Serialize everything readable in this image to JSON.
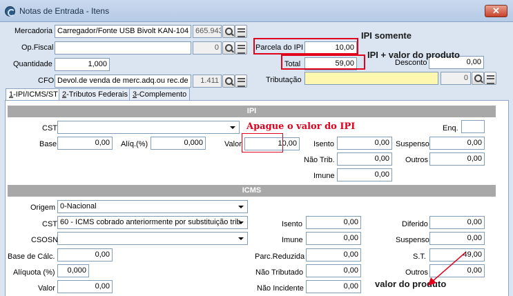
{
  "window": {
    "title": "Notas de Entrada - Itens",
    "close": "✕"
  },
  "header": {
    "mercadoria": {
      "label": "Mercadoria",
      "value": "Carregador/Fonte USB Bivolt KAN-104 -",
      "code": "665.943"
    },
    "opfiscal": {
      "label": "Op.Fiscal",
      "value": "",
      "code": "0"
    },
    "quantidade": {
      "label": "Quantidade",
      "value": "1,000"
    },
    "cfo": {
      "label": "CFO",
      "value": "Devol.de venda de merc.adq.ou rec.de",
      "code": "1.411"
    },
    "parcela_ipi": {
      "label": "Parcela do IPI",
      "value": "10,00"
    },
    "total": {
      "label": "Total",
      "value": "59,00"
    },
    "desconto": {
      "label": "Desconto",
      "value": "0,00"
    },
    "tributacao": {
      "label": "Tributação",
      "value": "",
      "code": "0"
    }
  },
  "tabs": [
    {
      "key": "1",
      "label": "-IPI/ICMS/ST"
    },
    {
      "key": "2",
      "label": "-Tributos Federais"
    },
    {
      "key": "3",
      "label": "-Complemento"
    }
  ],
  "ipi": {
    "title": "IPI",
    "cst_label": "CST",
    "cst_value": "",
    "enq_label": "Enq.",
    "enq_value": "",
    "base_label": "Base",
    "base_value": "0,00",
    "aliq_label": "Alíq.(%)",
    "aliq_value": "0,000",
    "valor_label": "Valor",
    "valor_value": "10,00",
    "isento_label": "Isento",
    "isento_value": "0,00",
    "suspenso_label": "Suspenso",
    "suspenso_value": "0,00",
    "naotrib_label": "Não Trib.",
    "naotrib_value": "0,00",
    "outros_label": "Outros",
    "outros_value": "0,00",
    "imune_label": "Imune",
    "imune_value": "0,00"
  },
  "icms": {
    "title": "ICMS",
    "origem_label": "Origem",
    "origem_value": "0-Nacional",
    "cst_label": "CST",
    "cst_value": "60 - ICMS cobrado anteriormente por substituição trib",
    "csosn_label": "CSOSN",
    "csosn_value": "",
    "base_label": "Base de Cálc.",
    "base_value": "0,00",
    "aliq_label": "Alíquota (%)",
    "aliq_value": "0,000",
    "valor_label": "Valor",
    "valor_value": "0,00",
    "isento_label": "Isento",
    "isento_value": "0,00",
    "imune_label": "Imune",
    "imune_value": "0,00",
    "parcred_label": "Parc.Reduzida",
    "parcred_value": "0,00",
    "naotrib_label": "Não Tributado",
    "naotrib_value": "0,00",
    "naoinc_label": "Não Incidente",
    "naoinc_value": "0,00",
    "diferido_label": "Diferido",
    "diferido_value": "0,00",
    "suspenso_label": "Suspenso",
    "suspenso_value": "0,00",
    "st_label": "S.T.",
    "st_value": "49,00",
    "outros_label": "Outros",
    "outros_value": "0,00"
  },
  "annotations": {
    "ipi_somente": "IPI somente",
    "ipi_mais_produto": "IPI + valor do produto",
    "apague": "Apague o valor do IPI",
    "valor_produto": "valor do produto"
  },
  "colors": {
    "annotation_red": "#e0001b",
    "section_bar": "#a8a8a8",
    "tributacao_bg": "#fdf7b0"
  }
}
